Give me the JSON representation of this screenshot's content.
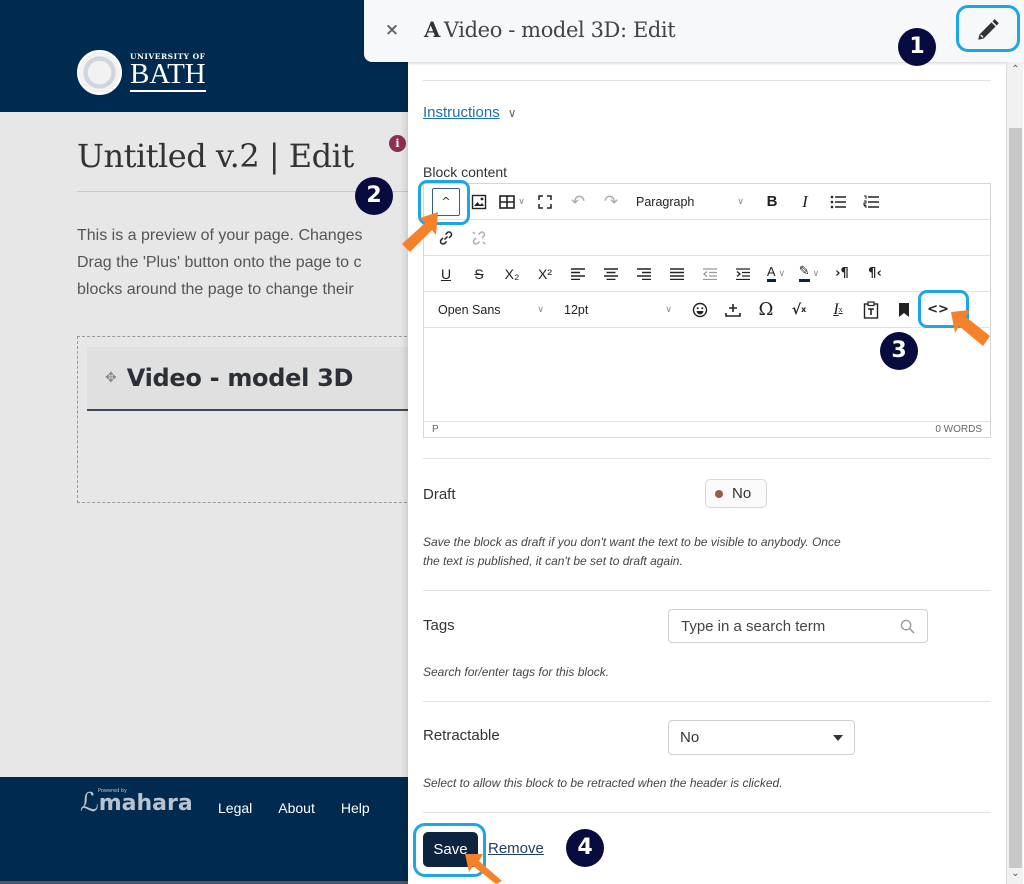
{
  "site": {
    "logo_small": "UNIVERSITY OF",
    "logo_big": "BATH",
    "page_title": "Untitled v.2 | Edit",
    "info_icon": "i",
    "preview_lines": [
      "This is a preview of your page. Changes",
      "Drag the 'Plus' button onto the page to c",
      "blocks around the page to change their"
    ],
    "block_title": "Video - model 3D",
    "move_icon": "✥",
    "footer": {
      "powered_by": "Powered by",
      "logo_text": "mahara",
      "links": [
        "Legal",
        "About",
        "Help"
      ]
    }
  },
  "panel": {
    "close_icon": "×",
    "type_letter": "A",
    "title": "Video - model 3D: Edit",
    "instructions_label": "Instructions",
    "instructions_chevron": "∨",
    "block_content_label": "Block content",
    "editor": {
      "row1": {
        "collapse": "^",
        "paragraph_select": "Paragraph",
        "bold": "B",
        "italic": "I"
      },
      "row3": {
        "underline": "U",
        "strikethrough": "S",
        "subscript": "X₂",
        "superscript": "X²",
        "ltr": "¶",
        "rtl": "¶"
      },
      "row4": {
        "font_select": "Open Sans",
        "size_select": "12pt",
        "omega": "Ω",
        "sqrt": "√",
        "clear_format": "I",
        "code": "<>"
      },
      "status_path": "P",
      "word_count": "0 WORDS"
    },
    "draft": {
      "label": "Draft",
      "value": "No",
      "help": [
        "Save the block as draft if you don't want the text to be visible to anybody. Once",
        "the text is published, it can't be set to draft again."
      ]
    },
    "tags": {
      "label": "Tags",
      "placeholder": "Type in a search term",
      "help": "Search for/enter tags for this block."
    },
    "retractable": {
      "label": "Retractable",
      "value": "No",
      "help": "Select to allow this block to be retracted when the header is clicked."
    },
    "save_label": "Save",
    "remove_label": "Remove"
  },
  "annotations": {
    "badges": [
      "1",
      "2",
      "3",
      "4"
    ],
    "ring_color": "#1da5e8",
    "arrow_color": "#f5822a",
    "badge_color": "#070b3d"
  }
}
